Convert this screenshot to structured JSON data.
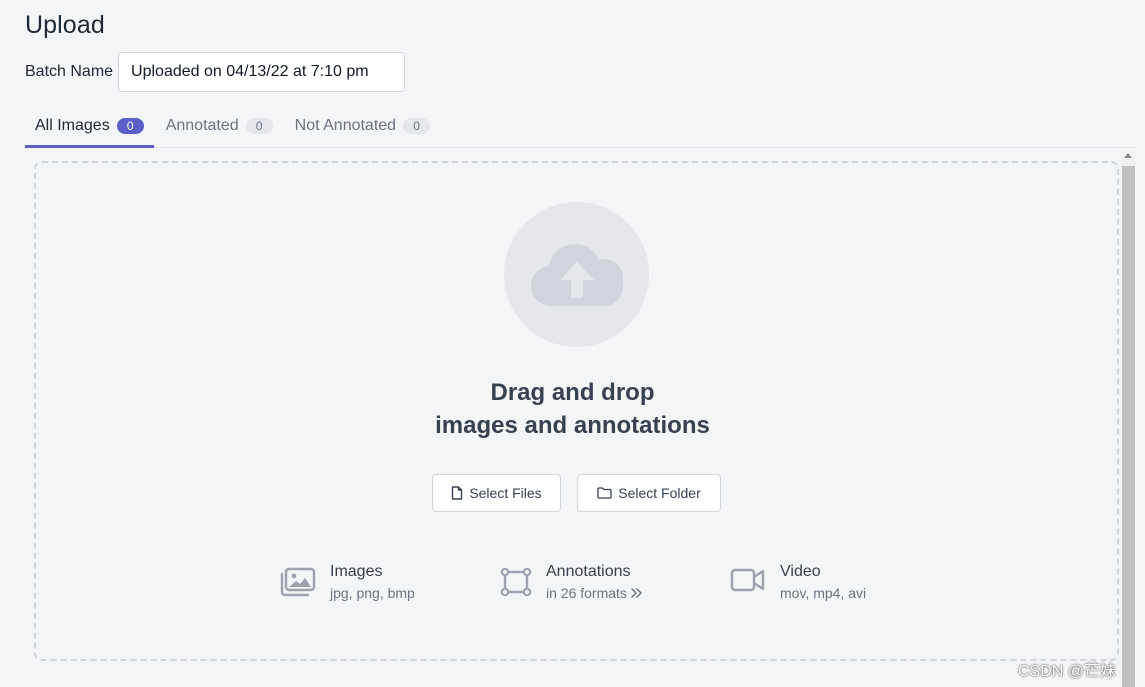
{
  "page": {
    "title": "Upload"
  },
  "batch": {
    "label": "Batch Name",
    "value": "Uploaded on 04/13/22 at 7:10 pm"
  },
  "tabs": [
    {
      "label": "All Images",
      "count": "0",
      "active": true
    },
    {
      "label": "Annotated",
      "count": "0",
      "active": false
    },
    {
      "label": "Not Annotated",
      "count": "0",
      "active": false
    }
  ],
  "dropzone": {
    "headline_line1": "Drag and drop",
    "headline_line2": "images and annotations",
    "select_files_label": "Select Files",
    "select_folder_label": "Select Folder",
    "upload_icon": "cloud-upload-icon"
  },
  "features": [
    {
      "name": "Images",
      "desc": "jpg, png, bmp",
      "icon": "images-icon"
    },
    {
      "name": "Annotations",
      "desc": "in 26 formats",
      "icon": "bounding-box-icon"
    },
    {
      "name": "Video",
      "desc": "mov, mp4, avi",
      "icon": "video-camera-icon"
    }
  ],
  "colors": {
    "accent": "#5b5fc7",
    "background": "#f4f5f7",
    "muted_text": "#6b7280"
  },
  "watermark": "CSDN @芒妹"
}
